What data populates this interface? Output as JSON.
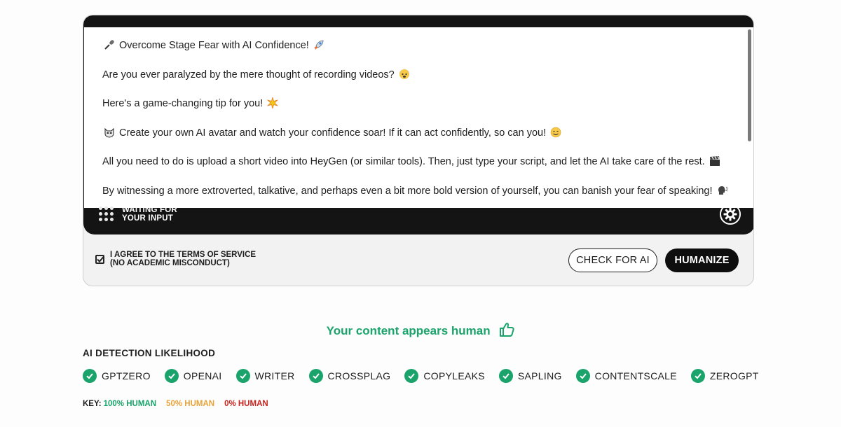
{
  "editor": {
    "paragraphs": [
      {
        "text": "Overcome Stage Fear with AI Confidence!",
        "lead_icon": "microphone-icon",
        "trail_icon": "rocket-icon"
      },
      {
        "text": "Are you ever paralyzed by the mere thought of recording videos?",
        "trail_icon": "anxious-face-icon"
      },
      {
        "text": "Here's a game-changing tip for you!",
        "trail_icon": "sparkle-icon"
      },
      {
        "text": "Create your own AI avatar and watch your confidence soar! If it can act confidently, so can you!",
        "lead_icon": "mask-icon",
        "trail_icon": "smile-icon"
      },
      {
        "text": "All you need to do is upload a short video into HeyGen (or similar tools). Then, just type your script, and let the AI take care of the rest.",
        "trail_icon": "clapper-board-icon"
      },
      {
        "text": "By witnessing a more extroverted, talkative, and perhaps even a bit more bold version of yourself, you can banish your fear of speaking!",
        "trail_icon": "speaking-head-icon"
      }
    ]
  },
  "status": {
    "line1": "WAITING FOR",
    "line2": "YOUR INPUT"
  },
  "terms": {
    "line1": "I AGREE TO THE TERMS OF SERVICE",
    "line2": "(NO ACADEMIC MISCONDUCT)",
    "checked": true
  },
  "buttons": {
    "check": "CHECK FOR AI",
    "humanize": "HUMANIZE"
  },
  "result": {
    "message": "Your content appears human",
    "icon": "thumbs-up-icon"
  },
  "detection": {
    "title": "AI DETECTION LIKELIHOOD",
    "detectors": [
      "GPTZERO",
      "OPENAI",
      "WRITER",
      "CROSSPLAG",
      "COPYLEAKS",
      "SAPLING",
      "CONTENTSCALE",
      "ZEROGPT"
    ]
  },
  "key": {
    "label": "KEY:",
    "items": [
      {
        "text": "100% HUMAN",
        "color": "#1aa36a"
      },
      {
        "text": "50% HUMAN",
        "color": "#e8a33a"
      },
      {
        "text": "0% HUMAN",
        "color": "#c8241e"
      }
    ]
  },
  "colors": {
    "accent_green": "#1aa36a",
    "dark": "#141414"
  }
}
